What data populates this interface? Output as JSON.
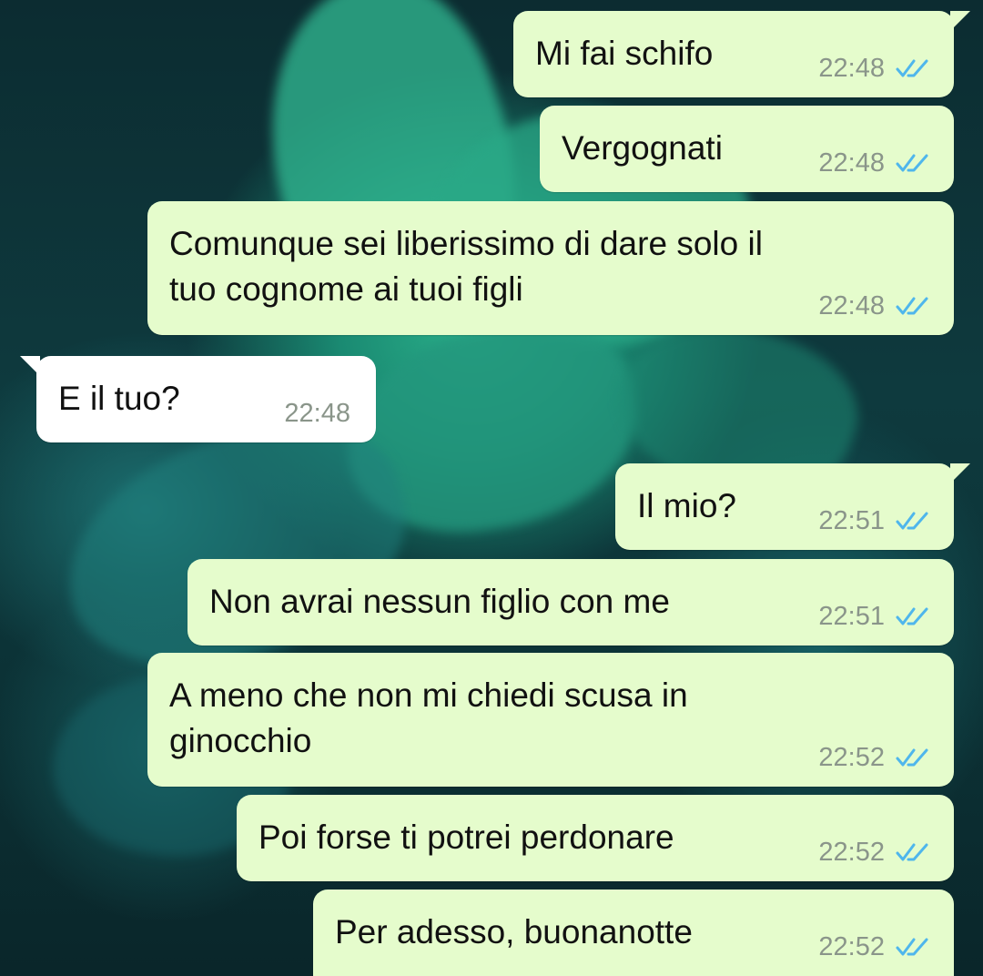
{
  "chat": {
    "messages": [
      {
        "direction": "outgoing",
        "text": "Mi fai schifo",
        "time": "22:48",
        "status": "read"
      },
      {
        "direction": "outgoing",
        "text": "Vergognati",
        "time": "22:48",
        "status": "read"
      },
      {
        "direction": "outgoing",
        "text": "Comunque sei liberissimo di dare solo il\ntuo cognome ai tuoi figli",
        "time": "22:48",
        "status": "read"
      },
      {
        "direction": "incoming",
        "text": "E il tuo?",
        "time": "22:48"
      },
      {
        "direction": "outgoing",
        "text": "Il mio?",
        "time": "22:51",
        "status": "read"
      },
      {
        "direction": "outgoing",
        "text": "Non avrai nessun figlio con me",
        "time": "22:51",
        "status": "read"
      },
      {
        "direction": "outgoing",
        "text": "A meno che non mi chiedi scusa in\nginocchio",
        "time": "22:52",
        "status": "read"
      },
      {
        "direction": "outgoing",
        "text": "Poi forse ti potrei perdonare",
        "time": "22:52",
        "status": "read"
      },
      {
        "direction": "outgoing",
        "text": "Per adesso, buonanotte",
        "time": "22:52",
        "status": "read"
      }
    ]
  },
  "colors": {
    "outgoing_bubble": "#e5fccc",
    "incoming_bubble": "#ffffff",
    "read_tick": "#4fb6ec",
    "timestamp": "#8a958a"
  },
  "icons": {
    "read_receipt": "double-check-icon"
  }
}
